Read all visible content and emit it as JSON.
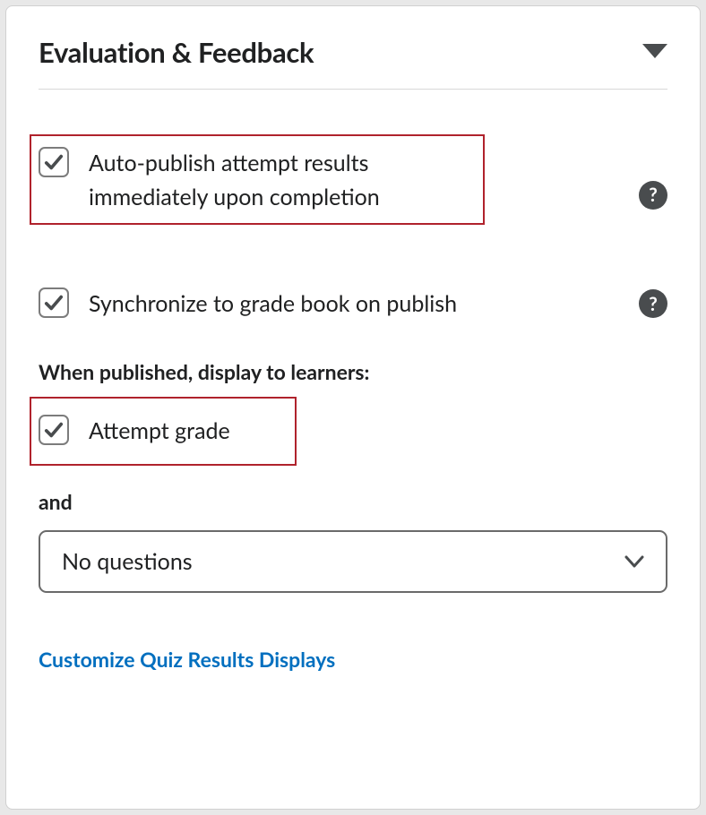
{
  "panel": {
    "title": "Evaluation & Feedback"
  },
  "options": {
    "autoPublish": {
      "label": "Auto-publish attempt results immediately upon completion",
      "checked": true
    },
    "syncGradebook": {
      "label": "Synchronize to grade book on publish",
      "checked": true
    }
  },
  "display": {
    "heading": "When published, display to learners:",
    "attemptGrade": {
      "label": "Attempt grade",
      "checked": true
    },
    "andLabel": "and",
    "dropdown": {
      "selected": "No questions"
    }
  },
  "links": {
    "customize": "Customize Quiz Results Displays"
  }
}
